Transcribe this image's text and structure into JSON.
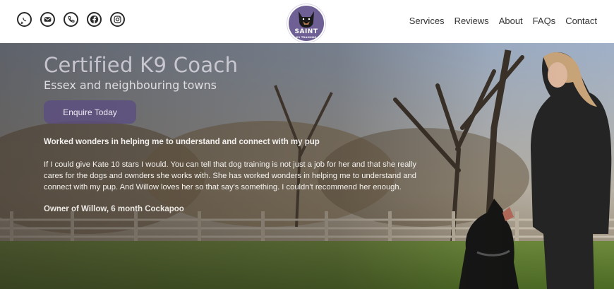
{
  "header": {
    "socials": [
      {
        "icon": "whatsapp-icon"
      },
      {
        "icon": "email-icon"
      },
      {
        "icon": "phone-icon"
      },
      {
        "icon": "facebook-icon"
      },
      {
        "icon": "instagram-icon"
      }
    ],
    "logo": {
      "title": "SAINT",
      "subtitle": "K9 TRAINING"
    },
    "nav": [
      "Services",
      "Reviews",
      "About",
      "FAQs",
      "Contact"
    ]
  },
  "hero": {
    "title": "Certified K9 Coach",
    "subtitle": "Essex and neighbouring towns",
    "cta_label": "Enquire Today",
    "testimonial": {
      "headline": "Worked wonders in helping me to understand and connect with my pup",
      "body": "If I could give Kate 10 stars I would. You can tell that dog training is not just a job for her and that she really cares for the dogs and ownders she works with. She has worked wonders in helping me to understand and connect with my pup. And Willow loves her so that say's something. I couldn't recommend her enough.",
      "author": "Owner of Willow, 6 month Cockapoo"
    }
  },
  "colors": {
    "brand_purple": "#6e5f94",
    "button": "#5c4e80",
    "nav_text": "#333333"
  }
}
